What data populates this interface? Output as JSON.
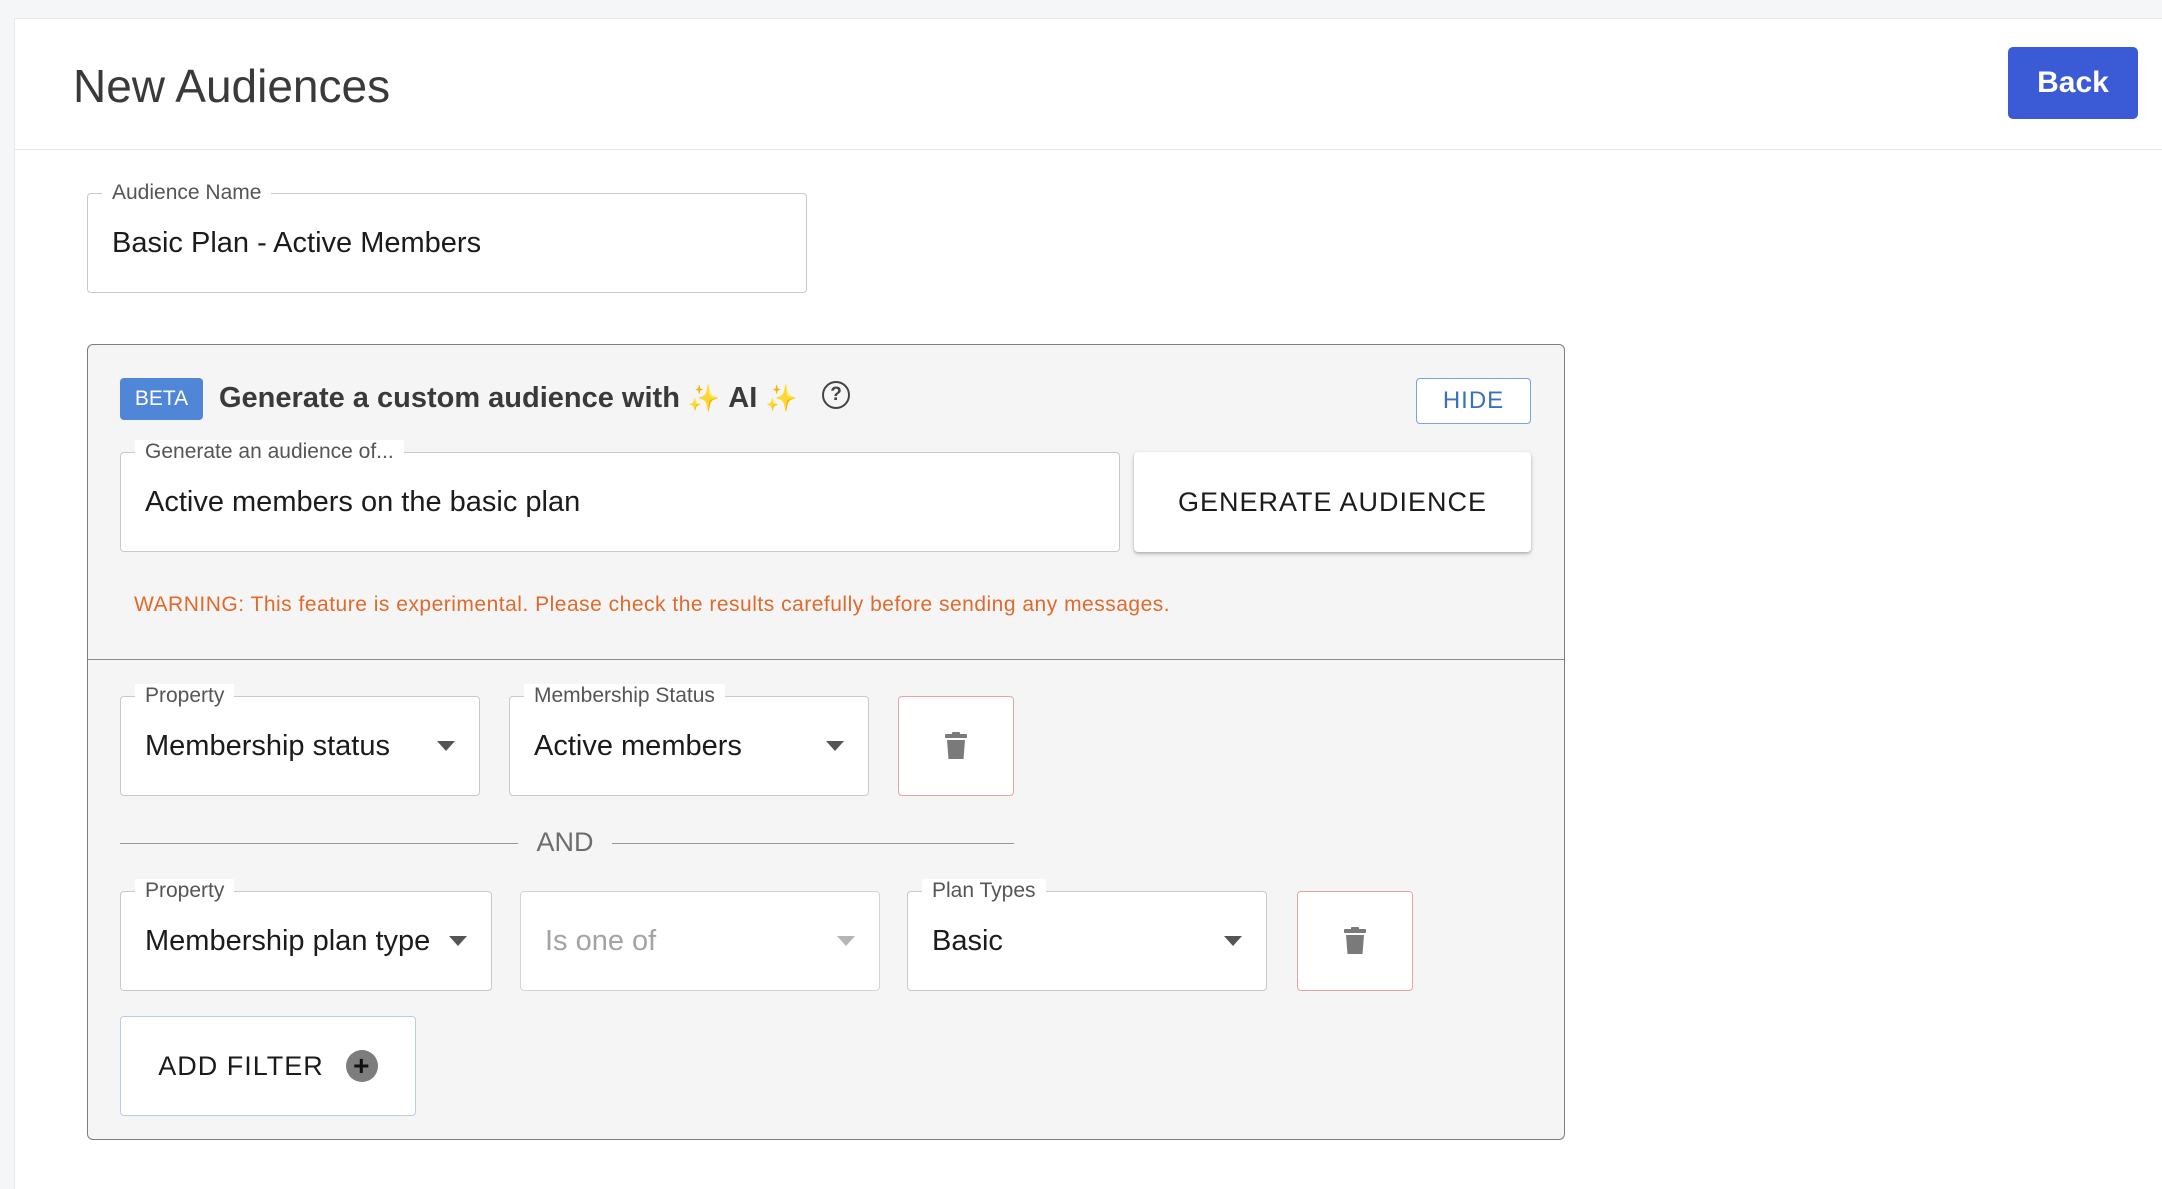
{
  "header": {
    "title": "New Audiences",
    "back_label": "Back"
  },
  "audience_name": {
    "label": "Audience Name",
    "value": "Basic Plan - Active Members"
  },
  "ai": {
    "badge": "BETA",
    "title_prefix": "Generate a custom audience with",
    "sparkle": "✨",
    "title_ai": "AI",
    "hide_label": "HIDE",
    "prompt_label": "Generate an audience of...",
    "prompt_value": "Active members on the basic plan",
    "generate_label": "GENERATE AUDIENCE",
    "warning": "WARNING: This feature is experimental. Please check the results carefully before sending any messages."
  },
  "filters": [
    {
      "property_label": "Property",
      "property_value": "Membership status",
      "value_label": "Membership Status",
      "value_value": "Active members"
    },
    {
      "property_label": "Property",
      "property_value": "Membership plan type",
      "operator_value": "Is one of",
      "value_label": "Plan Types",
      "value_value": "Basic"
    }
  ],
  "and_label": "AND",
  "add_filter_label": "ADD FILTER",
  "icons": {
    "help": "help-circle-icon",
    "trash": "trash-icon",
    "plus": "plus-circle-icon",
    "caret": "caret-down-icon"
  },
  "colors": {
    "primary": "#3b5bd6",
    "beta_badge": "#4f86d8",
    "warning": "#e06a2c",
    "delete_border": "#e6a3a3"
  }
}
